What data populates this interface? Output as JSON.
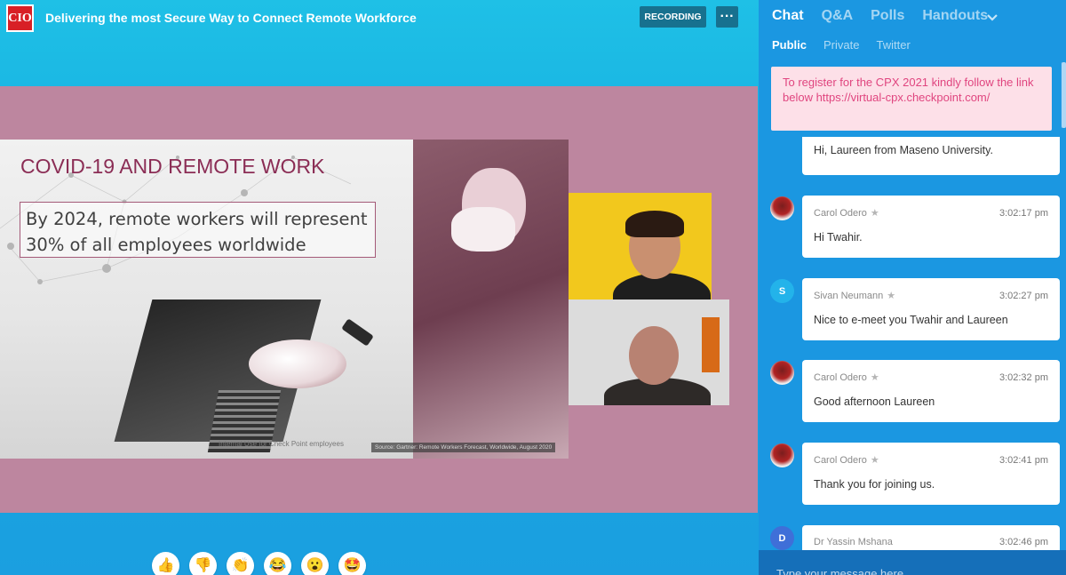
{
  "header": {
    "logo_text": "CIO",
    "title": "Delivering the most Secure Way to Connect Remote Workforce",
    "recording_label": "RECORDING",
    "more_label": "···"
  },
  "slide": {
    "heading": "COVID-19 AND REMOTE WORK",
    "line1": "By 2024, remote workers will represent",
    "line2": "30% of all employees worldwide",
    "footer_left": "Internal Use for Check Point employees",
    "footer_right": "Source: Gartner: Remote Workers Forecast, Worldwide, August 2020"
  },
  "reactions": [
    {
      "name": "thumbs-up",
      "glyph": "👍"
    },
    {
      "name": "thumbs-down",
      "glyph": "👎"
    },
    {
      "name": "clap",
      "glyph": "👏"
    },
    {
      "name": "laugh",
      "glyph": "😂"
    },
    {
      "name": "surprised",
      "glyph": "😮"
    },
    {
      "name": "star-struck",
      "glyph": "🤩"
    }
  ],
  "sidebar": {
    "tabs": [
      "Chat",
      "Q&A",
      "Polls",
      "Handouts"
    ],
    "chevron": "⌄",
    "subtabs": [
      "Public",
      "Private",
      "Twitter"
    ],
    "pinned": "To register for the CPX 2021 kindly follow the link below https://virtual-cpx.checkpoint.com/",
    "messages": [
      {
        "author": "",
        "time": "",
        "text": "Hi, Laureen from Maseno University."
      },
      {
        "author": "Carol Odero",
        "time": "3:02:17 pm",
        "text": "Hi Twahir."
      },
      {
        "author": "Sivan Neumann",
        "time": "3:02:27 pm",
        "text": "Nice to e-meet you Twahir and Laureen",
        "initial": "S"
      },
      {
        "author": "Carol Odero",
        "time": "3:02:32 pm",
        "text": "Good afternoon Laureen"
      },
      {
        "author": "Carol Odero",
        "time": "3:02:41 pm",
        "text": "Thank you for joining us."
      },
      {
        "author": "Dr Yassin Mshana",
        "time": "3:02:46 pm",
        "text": "",
        "initial": "D"
      }
    ],
    "composer_placeholder": "Type your message here"
  },
  "colors": {
    "accent": "#1b97e1",
    "stage_bg": "#bd869f",
    "heading": "#8b2d55",
    "pinned_text": "#e0457f"
  }
}
